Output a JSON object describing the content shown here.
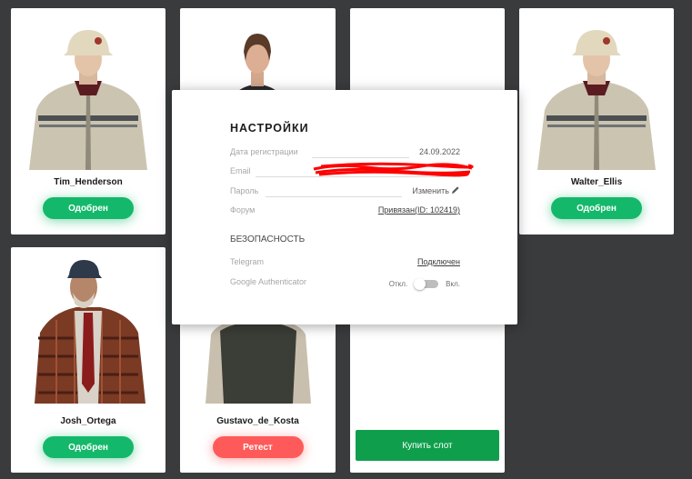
{
  "cards": [
    {
      "name": "Tim_Henderson",
      "status": "Одобрен"
    },
    {
      "name": "Walter_Ellis",
      "status": "Одобрен"
    },
    {
      "name": "Josh_Ortega",
      "status": "Одобрен"
    },
    {
      "name": "Gustavo_de_Kosta",
      "status": "Ретест"
    }
  ],
  "buy_slot": "Купить слот",
  "settings": {
    "title": "НАСТРОЙКИ",
    "rows": {
      "reg_date": {
        "label": "Дата регистрации",
        "value": "24.09.2022"
      },
      "email": {
        "label": "Email"
      },
      "password": {
        "label": "Пароль",
        "action": "Изменить"
      },
      "forum": {
        "label": "Форум",
        "value": "Привязан(ID: 102419)"
      }
    },
    "security": {
      "title": "БЕЗОПАСНОСТЬ",
      "telegram": {
        "label": "Telegram",
        "value": "Подключен"
      },
      "ga": {
        "label": "Google Authenticator",
        "off": "Откл.",
        "on": "Вкл."
      }
    }
  },
  "colors": {
    "background": "#3a3b3d",
    "approved": "#14b86a",
    "retest": "#ff5a5a",
    "buy": "#0f9f4c"
  },
  "icons": {
    "edit": "pencil-icon"
  }
}
